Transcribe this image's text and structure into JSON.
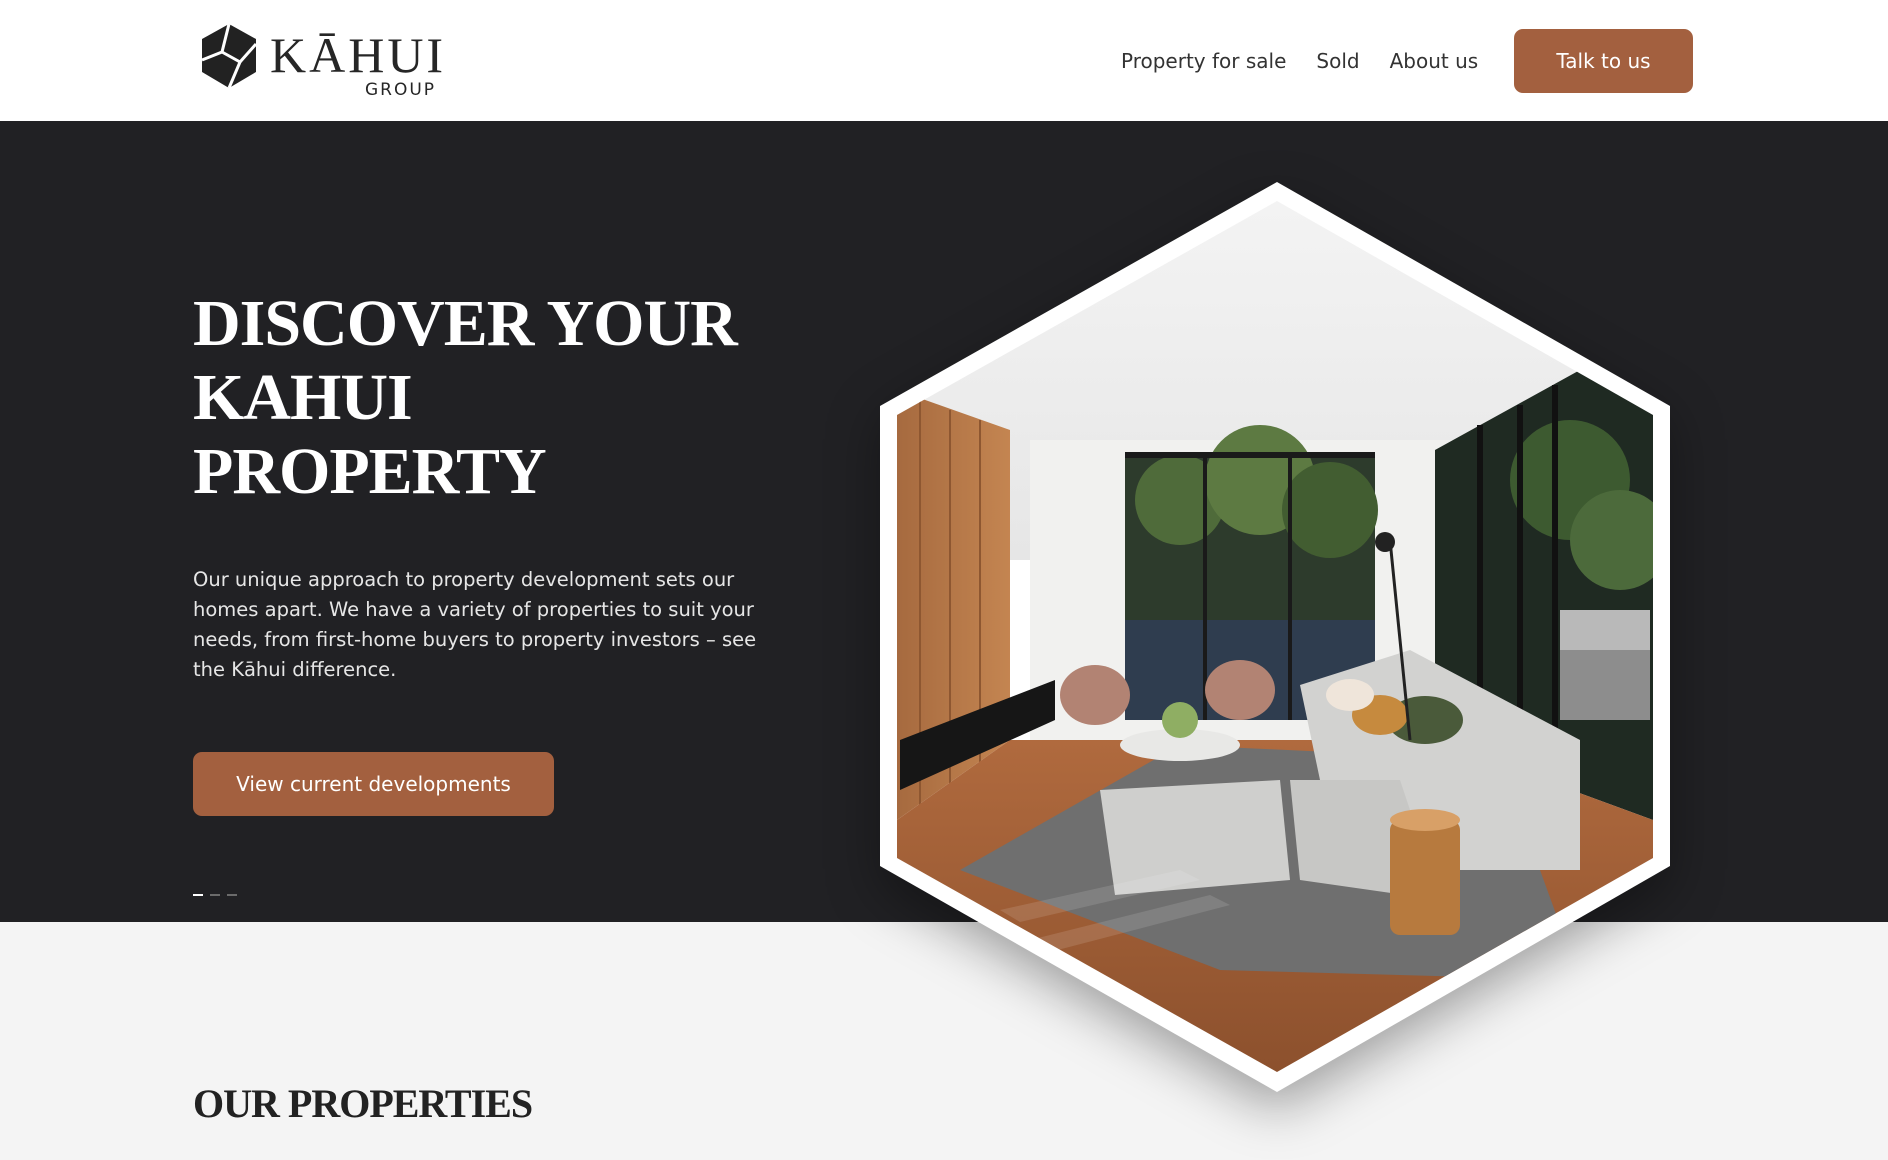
{
  "brand": {
    "name": "KĀHUI",
    "sub": "GROUP"
  },
  "nav": {
    "items": [
      {
        "label": "Property for sale"
      },
      {
        "label": "Sold"
      },
      {
        "label": "About us"
      }
    ],
    "cta_label": "Talk to us"
  },
  "hero": {
    "title_lines": [
      "DISCOVER YOUR",
      "KAHUI",
      "PROPERTY"
    ],
    "body": "Our unique approach to property development sets our homes apart. We have a variety of properties to suit your needs, from first-home buyers to property investors – see the Kāhui difference.",
    "cta_label": "View current developments",
    "slide_count": 3,
    "active_slide": 1
  },
  "properties": {
    "title": "OUR PROPERTIES"
  },
  "colors": {
    "accent": "#a3603f",
    "hero_bg": "#212124",
    "page_bg": "#f4f4f4"
  },
  "icons": {
    "logo": "kahui-hexagon-logo-icon"
  }
}
